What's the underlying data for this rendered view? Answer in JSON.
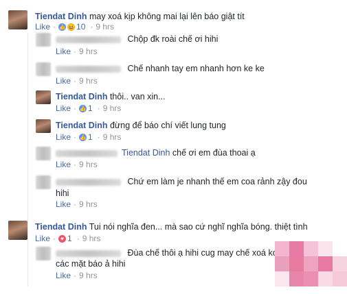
{
  "comments": [
    {
      "author": "Tiendat Dinh",
      "text": "may xoá kịp không mai lại lên báo giật tít",
      "like": "Like",
      "reactions": [
        "like-reaction-icon",
        "haha-reaction-icon"
      ],
      "count": "10",
      "time": "9 hrs"
    },
    {
      "text": "Chộp đk roài chế ơi hihi",
      "like": "Like",
      "time": "9 hrs"
    },
    {
      "text": "Chế nhanh tay em nhanh hơn ke ke",
      "like": "Like",
      "time": "9 hrs"
    },
    {
      "author": "Tiendat Dinh",
      "text": "thôi.. van xin...",
      "like": "Like",
      "reactions": [
        "like-reaction-icon"
      ],
      "count": "1",
      "time": "9 hrs"
    },
    {
      "author": "Tiendat Dinh",
      "text": "đừng để báo chí viết lung tung",
      "like": "Like",
      "reactions": [
        "like-reaction-icon"
      ],
      "count": "1",
      "time": "9 hrs"
    },
    {
      "mention": "Tiendat Dinh",
      "text": "chế ơi em đùa thoai ạ",
      "like": "Like",
      "time": "9 hrs"
    },
    {
      "text": "Chứ em làm je nhanh thế em coa rảnh zậy đou",
      "text2": "hihi",
      "like": "Like",
      "time": "9 hrs"
    },
    {
      "author": "Tiendat Dinh",
      "text": "Tui nói nghĩa đen... mà sao cứ nghĩ nghĩa bóng. thiệt tình",
      "like": "Like",
      "reactions": [
        "love-reaction-icon"
      ],
      "count": "1",
      "time": "9 hrs"
    },
    {
      "text": "Đùa chế thôi ạ hihi cug may chế xoá ko n",
      "text2": "các mặt báo ả hihi",
      "like": "Like",
      "time": "9 hrs"
    }
  ],
  "colors": {
    "link": "#365899",
    "like": "#4267b2",
    "meta": "#90949c",
    "text": "#1d2129"
  }
}
